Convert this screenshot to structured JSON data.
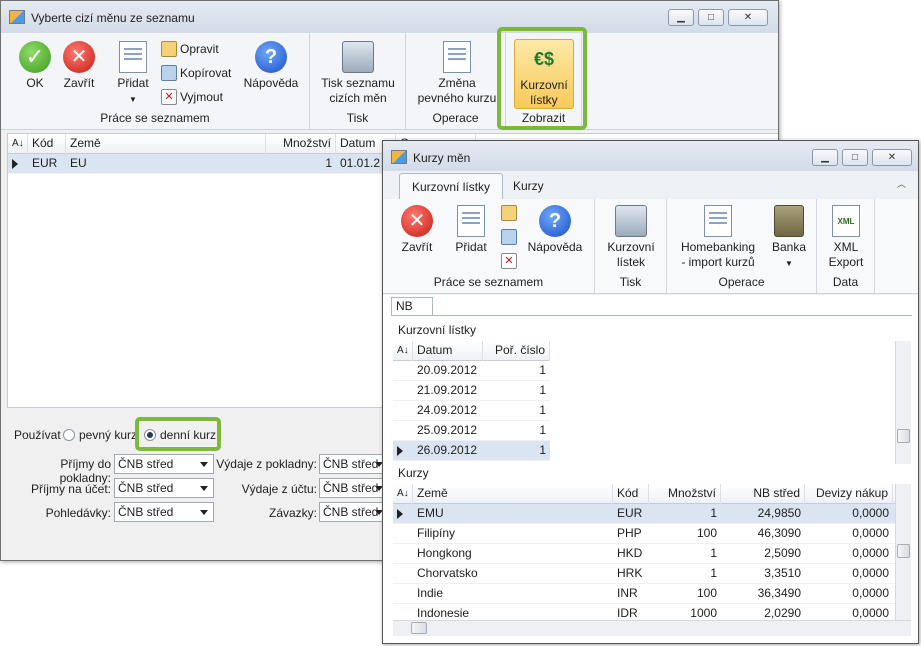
{
  "w1": {
    "title": "Vyberte cizí měnu ze seznamu",
    "ribbon": {
      "ok": "OK",
      "close": "Zavřít",
      "add": "Přidat",
      "edit": "Opravit",
      "copy": "Kopírovat",
      "cut": "Vyjmout",
      "help": "Nápověda",
      "group_list": "Práce se seznamem",
      "print_l1": "Tisk seznamu",
      "print_l2": "cizích měn",
      "group_print": "Tisk",
      "fixed_l1": "Změna",
      "fixed_l2": "pevného kurzu",
      "group_ops": "Operace",
      "rates_l1": "Kurzovní",
      "rates_l2": "lístky",
      "group_show": "Zobrazit"
    },
    "grid": {
      "headers": [
        "Kód",
        "Země",
        "Množství",
        "Datum",
        "Operace"
      ],
      "row": {
        "code": "EUR",
        "country": "EU",
        "qty": "1",
        "date": "01.01.2"
      }
    },
    "use_label": "Používat",
    "radio_fixed": "pevný kurz",
    "radio_daily": "denní kurz",
    "fields": [
      {
        "label": "Příjmy do pokladny:",
        "value": "ČNB střed"
      },
      {
        "label": "Příjmy na účet:",
        "value": "ČNB střed"
      },
      {
        "label": "Pohledávky:",
        "value": "ČNB střed"
      },
      {
        "label": "Výdaje z pokladny:",
        "value": "ČNB střed"
      },
      {
        "label": "Výdaje z účtu:",
        "value": "ČNB střed"
      },
      {
        "label": "Závazky:",
        "value": "ČNB střed"
      }
    ]
  },
  "w2": {
    "title": "Kurzy měn",
    "tabs": [
      "Kurzovní lístky",
      "Kurzy"
    ],
    "ribbon": {
      "close": "Zavřít",
      "add": "Přidat",
      "help": "Nápověda",
      "group_list": "Práce se seznamem",
      "rates_l1": "Kurzovní",
      "rates_l2": "lístek",
      "group_print": "Tisk",
      "hb_l1": "Homebanking",
      "hb_l2": "- import kurzů",
      "bank": "Banka",
      "group_ops": "Operace",
      "xml_l1": "XML",
      "xml_l2": "Export",
      "group_data": "Data"
    },
    "subtab": "NB",
    "sheets_label": "Kurzovní lístky",
    "sheets_headers": [
      "Datum",
      "Poř. číslo"
    ],
    "sheets": [
      {
        "date": "20.09.2012",
        "no": "1"
      },
      {
        "date": "21.09.2012",
        "no": "1"
      },
      {
        "date": "24.09.2012",
        "no": "1"
      },
      {
        "date": "25.09.2012",
        "no": "1"
      },
      {
        "date": "26.09.2012",
        "no": "1"
      }
    ],
    "rates_label": "Kurzy",
    "rates_headers": [
      "Země",
      "Kód",
      "Množství",
      "NB střed",
      "Devizy nákup"
    ],
    "rates": [
      {
        "country": "EMU",
        "code": "EUR",
        "qty": "1",
        "mid": "24,9850",
        "buy": "0,0000"
      },
      {
        "country": "Filipíny",
        "code": "PHP",
        "qty": "100",
        "mid": "46,3090",
        "buy": "0,0000"
      },
      {
        "country": "Hongkong",
        "code": "HKD",
        "qty": "1",
        "mid": "2,5090",
        "buy": "0,0000"
      },
      {
        "country": "Chorvatsko",
        "code": "HRK",
        "qty": "1",
        "mid": "3,3510",
        "buy": "0,0000"
      },
      {
        "country": "Indie",
        "code": "INR",
        "qty": "100",
        "mid": "36,3490",
        "buy": "0,0000"
      },
      {
        "country": "Indonesie",
        "code": "IDR",
        "qty": "1000",
        "mid": "2,0290",
        "buy": "0,0000"
      }
    ]
  }
}
